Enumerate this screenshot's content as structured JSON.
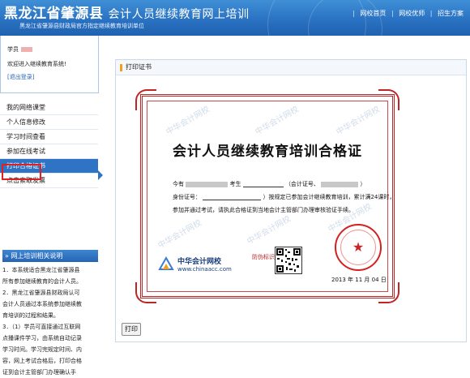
{
  "header": {
    "title_main": "黑龙江省肇源县",
    "title_rest": "会计人员继续教育网上培训",
    "subtitle": "黑龙江省肇源县财政局官方指定继续教育培训单位",
    "links": [
      "网校首页",
      "网校优师",
      "招生方案"
    ]
  },
  "user": {
    "label": "学员",
    "welcome": "欢迎进入继续教育系统!",
    "logout": "[退出登录]"
  },
  "menu": {
    "items": [
      "我的网络课堂",
      "个人信息修改",
      "学习时间查看",
      "参加在线考试",
      "打印合格证书",
      "点击索取发票"
    ],
    "active_index": 4
  },
  "notice": {
    "heading": "» 网上培训相关说明",
    "lines": [
      "1．本系统适合黑龙江省肇源县",
      "所有参加继续教育的会计人员。",
      "2．黑龙江省肇源县财政局认可",
      "会计人员通过本系统参加继续教",
      "育培训的过程和结果。",
      "3．（1）学员可直接通过互联网",
      "点播课件学习，由系统自动记录",
      "学习时间。学习完规定时间、内",
      "容，网上考试合格后，打印合格",
      "证到会计主管部门办理确认手"
    ]
  },
  "panel": {
    "title": "打印证书"
  },
  "certificate": {
    "title": "会计人员继续教育培训合格证",
    "line1_prefix": "今有",
    "line1_mid": "考生",
    "line1_cert_label": "（会计证号、",
    "line1_suffix": "）",
    "line2_prefix": "身份证号：",
    "line2_text": "）按规定已参加会计继续教育培训，累计满24课时，",
    "line3_text": "参加并通过考试，请执此合格证到当地会计主管部门办理审核验证手续。",
    "watermark": "中华会计网校",
    "logo_cn": "中华会计网校",
    "logo_url": "www.chinaacc.com",
    "anti_fake_label": "防伪标识：",
    "date": "2013 年 11 月 04 日"
  },
  "print_button": "打印",
  "colors": {
    "header_blue": "#2a72c2",
    "active_menu": "#2f73c5",
    "cert_red": "#c02424"
  }
}
